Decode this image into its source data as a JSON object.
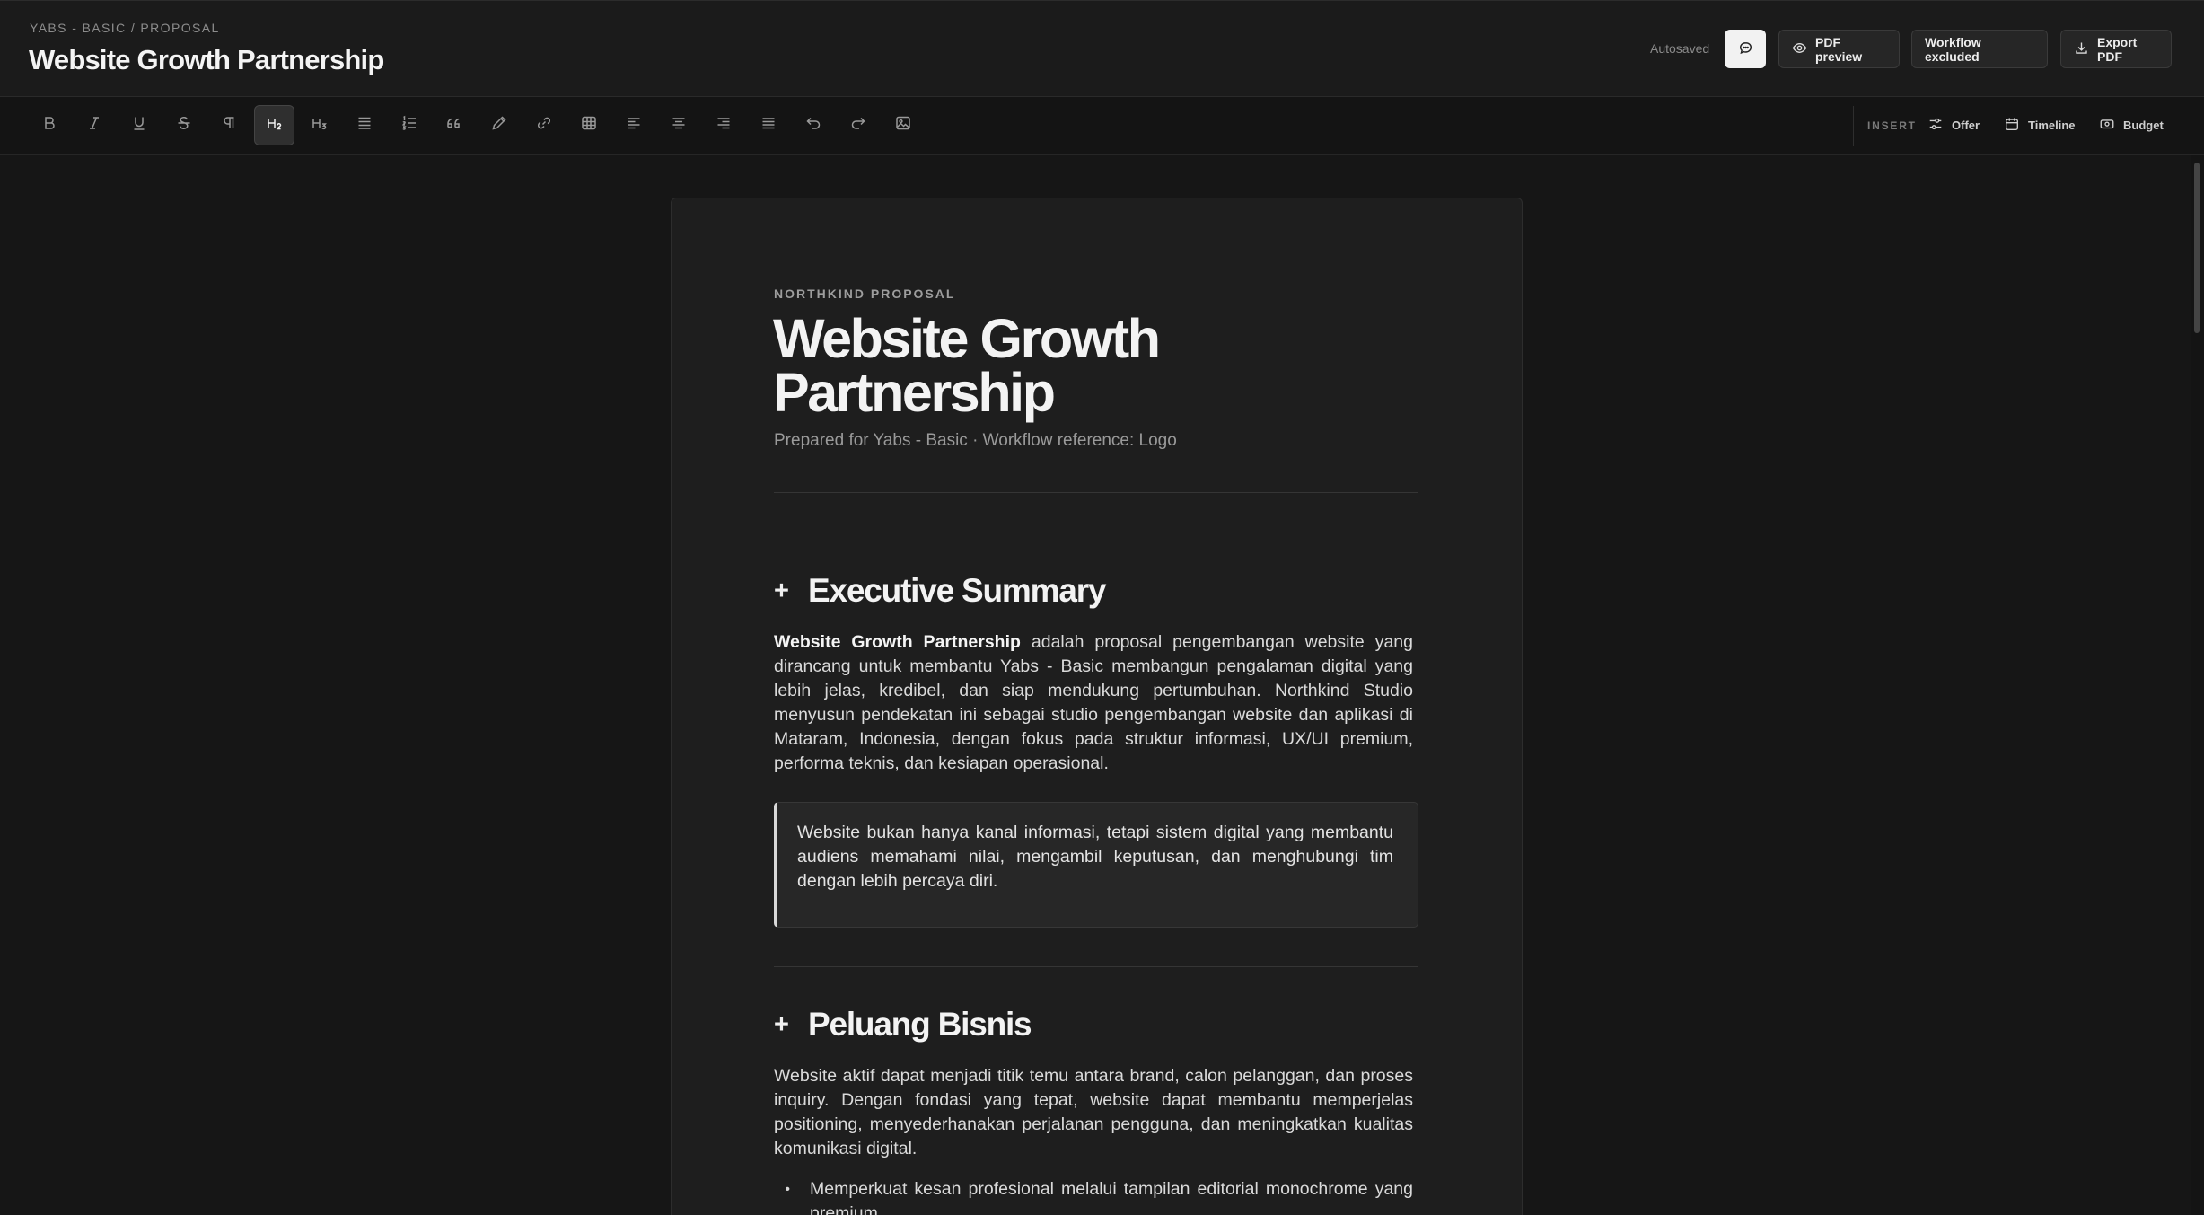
{
  "header": {
    "breadcrumb": "YABS - BASIC / PROPOSAL",
    "title": "Website Growth Partnership",
    "autosaved": "Autosaved",
    "buttons": {
      "comment_icon": "comment-icon",
      "pdf_preview": "PDF preview",
      "workflow": "Workflow excluded",
      "export": "Export PDF"
    }
  },
  "toolbar": {
    "tools": [
      "bold",
      "italic",
      "underline",
      "strikethrough",
      "paragraph",
      "heading-2",
      "heading-3",
      "bullet-list",
      "ordered-list",
      "blockquote",
      "highlight",
      "link",
      "table",
      "align-left",
      "align-center",
      "align-right",
      "align-justify",
      "undo",
      "redo",
      "image"
    ],
    "active_tool": "heading-2",
    "insert_label": "INSERT",
    "insert": {
      "offer": "Offer",
      "timeline": "Timeline",
      "budget": "Budget"
    }
  },
  "document": {
    "eyebrow": "NORTHKIND PROPOSAL",
    "title": "Website Growth Partnership",
    "subtitle": "Prepared for Yabs - Basic · Workflow reference: Logo",
    "sections": [
      {
        "title": "Executive Summary",
        "lead_bold": "Website Growth Partnership",
        "body": " adalah proposal pengembangan website yang dirancang untuk membantu Yabs - Basic membangun pengalaman digital yang lebih jelas, kredibel, dan siap mendukung pertumbuhan. Northkind Studio menyusun pendekatan ini sebagai studio pengembangan website dan aplikasi di Mataram, Indonesia, dengan fokus pada struktur informasi, UX/UI premium, performa teknis, dan kesiapan operasional.",
        "quote": "Website bukan hanya kanal informasi, tetapi sistem digital yang membantu audiens memahami nilai, mengambil keputusan, dan menghubungi tim dengan lebih percaya diri."
      },
      {
        "title": "Peluang Bisnis",
        "body": "Website aktif dapat menjadi titik temu antara brand, calon pelanggan, dan proses inquiry. Dengan fondasi yang tepat, website dapat membantu memperjelas positioning, menyederhanakan perjalanan pengguna, dan meningkatkan kualitas komunikasi digital.",
        "bullets": [
          "Memperkuat kesan profesional melalui tampilan editorial monochrome yang premium."
        ]
      }
    ]
  },
  "colors": {
    "background": "#161616",
    "paper": "#1e1e1e",
    "accent": "#f2f2f2"
  }
}
